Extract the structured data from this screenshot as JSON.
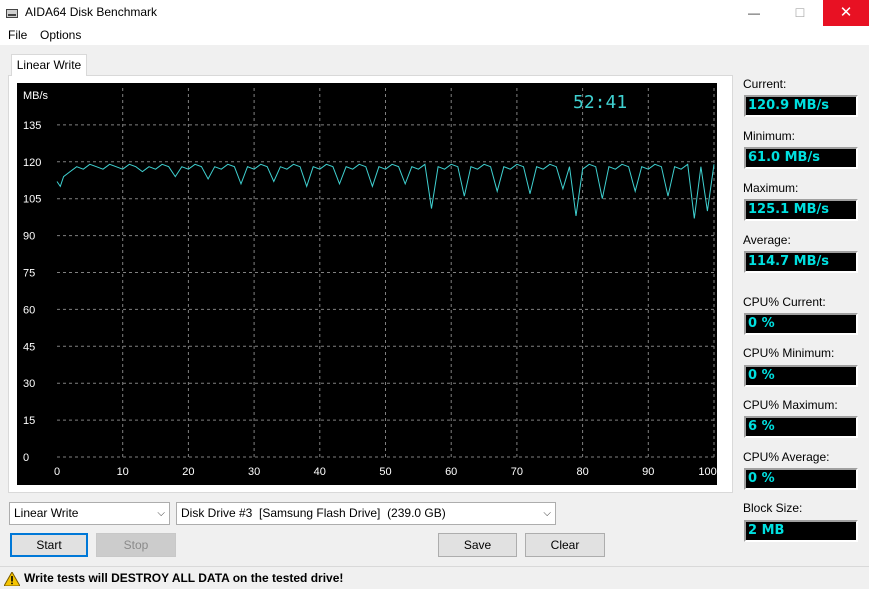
{
  "window": {
    "title": "AIDA64 Disk Benchmark",
    "minimize_glyph": "—",
    "maximize_glyph": "☐",
    "close_glyph": "✕"
  },
  "menu": [
    "File",
    "Options"
  ],
  "tab_label": "Linear Write",
  "chart_data": {
    "type": "line",
    "ylabel": "MB/s",
    "timer": "52:41",
    "x_ticks": [
      "0",
      "10",
      "20",
      "30",
      "40",
      "50",
      "60",
      "70",
      "80",
      "90",
      "100 %"
    ],
    "y_ticks": [
      "0",
      "15",
      "30",
      "45",
      "60",
      "75",
      "90",
      "105",
      "120",
      "135"
    ],
    "xlim": [
      0,
      100
    ],
    "ylim": [
      0,
      150
    ],
    "grid": true,
    "background": "#000000",
    "grid_color": "#808080",
    "line_color": "#3fd0d0",
    "series": [
      {
        "x": [
          0,
          0.5,
          1,
          2,
          3,
          4,
          5,
          6,
          7,
          8,
          9,
          10,
          11,
          12,
          13,
          14,
          15,
          16,
          17,
          18,
          19,
          20,
          21,
          22,
          23,
          24,
          25,
          26,
          27,
          28,
          29,
          30,
          31,
          32,
          33,
          34,
          35,
          36,
          37,
          38,
          39,
          40,
          41,
          42,
          43,
          44,
          45,
          46,
          47,
          48,
          49,
          50,
          51,
          52,
          53,
          54,
          55,
          56,
          57,
          58,
          59,
          60,
          61,
          62,
          63,
          64,
          65,
          66,
          67,
          68,
          69,
          70,
          71,
          72,
          73,
          74,
          75,
          76,
          77,
          78,
          79,
          80,
          81,
          82,
          83,
          84,
          85,
          86,
          87,
          88,
          89,
          90,
          91,
          92,
          93,
          94,
          95,
          96,
          97,
          98,
          99,
          100
        ],
        "values": [
          112,
          110,
          114,
          116,
          118,
          117,
          119,
          118,
          117,
          119,
          118,
          117,
          119,
          118,
          116,
          118,
          117,
          119,
          118,
          114,
          118,
          117,
          119,
          118,
          113,
          118,
          117,
          119,
          118,
          111,
          118,
          117,
          119,
          118,
          112,
          118,
          117,
          119,
          118,
          110,
          118,
          117,
          119,
          118,
          111,
          118,
          117,
          119,
          118,
          110,
          118,
          117,
          119,
          118,
          111,
          118,
          117,
          119,
          101,
          118,
          117,
          119,
          118,
          106,
          118,
          117,
          119,
          118,
          108,
          118,
          117,
          119,
          118,
          107,
          118,
          117,
          119,
          118,
          109,
          118,
          98,
          117,
          119,
          118,
          105,
          118,
          117,
          119,
          118,
          108,
          118,
          117,
          119,
          118,
          106,
          118,
          117,
          119,
          97,
          118,
          100,
          119
        ]
      }
    ]
  },
  "stats": [
    {
      "label": "Current:",
      "value": "120.9 MB/s"
    },
    {
      "label": "Minimum:",
      "value": "61.0 MB/s"
    },
    {
      "label": "Maximum:",
      "value": "125.1 MB/s"
    },
    {
      "label": "Average:",
      "value": "114.7 MB/s"
    },
    {
      "label": "CPU% Current:",
      "value": "0 %"
    },
    {
      "label": "CPU% Minimum:",
      "value": "0 %"
    },
    {
      "label": "CPU% Maximum:",
      "value": "6 %"
    },
    {
      "label": "CPU% Average:",
      "value": "0 %"
    },
    {
      "label": "Block Size:",
      "value": "2 MB"
    }
  ],
  "test_select": {
    "value": "Linear Write"
  },
  "drive_select": {
    "value": "Disk Drive #3  [Samsung Flash Drive]  (239.0 GB)"
  },
  "buttons": {
    "start": "Start",
    "stop": "Stop",
    "save": "Save",
    "clear": "Clear"
  },
  "status": {
    "warning": "Write tests will DESTROY ALL DATA on the tested drive!"
  }
}
